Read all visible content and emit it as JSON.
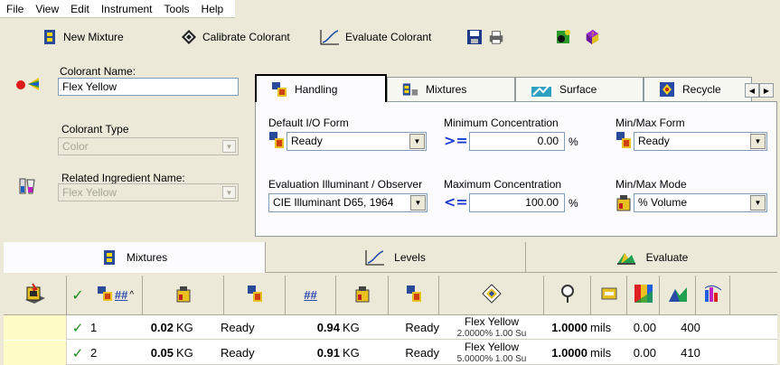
{
  "menu": [
    "File",
    "View",
    "Edit",
    "Instrument",
    "Tools",
    "Help"
  ],
  "toolbar": {
    "new_mixture": "New Mixture",
    "calibrate_colorant": "Calibrate Colorant",
    "evaluate_colorant": "Evaluate Colorant"
  },
  "left": {
    "colorant_name_label": "Colorant Name:",
    "colorant_name_value": "Flex Yellow",
    "colorant_type_label": "Colorant Type",
    "colorant_type_value": "Color",
    "related_label": "Related Ingredient Name:",
    "related_value": "Flex Yellow"
  },
  "tabs_top": [
    "Handling",
    "Mixtures",
    "Surface",
    "Recycle"
  ],
  "handling": {
    "default_io_label": "Default I/O Form",
    "default_io_value": "Ready",
    "min_conc_label": "Minimum Concentration",
    "min_conc_value": "0.00",
    "min_conc_unit": "%",
    "minmax_form_label": "Min/Max Form",
    "minmax_form_value": "Ready",
    "eval_illum_label": "Evaluation Illuminant / Observer",
    "eval_illum_value": "CIE Illuminant D65, 1964",
    "max_conc_label": "Maximum Concentration",
    "max_conc_value": "100.00",
    "max_conc_unit": "%",
    "minmax_mode_label": "Min/Max Mode",
    "minmax_mode_value": "% Volume",
    "gte_symbol": ">=",
    "lte_symbol": "<="
  },
  "tabs_bottom": [
    "Mixtures",
    "Levels",
    "Evaluate"
  ],
  "grid_header": {
    "hash1": "##",
    "hash2": "##",
    "sort": "^"
  },
  "rows": [
    {
      "check": "✓",
      "idx": "1",
      "qty1": "0.02",
      "unit1": "KG",
      "form1": "Ready",
      "qty2": "0.94",
      "unit2": "KG",
      "form2": "Ready",
      "name": "Flex Yellow",
      "sub": "2.0000% 1.00 Su",
      "thick": "1.0000",
      "thick_unit": "mils",
      "val": "0.00",
      "wl": "400"
    },
    {
      "check": "✓",
      "idx": "2",
      "qty1": "0.05",
      "unit1": "KG",
      "form1": "Ready",
      "qty2": "0.91",
      "unit2": "KG",
      "form2": "Ready",
      "name": "Flex Yellow",
      "sub": "5.0000% 1.00 Su",
      "thick": "1.0000",
      "thick_unit": "mils",
      "val": "0.00",
      "wl": "410"
    }
  ]
}
